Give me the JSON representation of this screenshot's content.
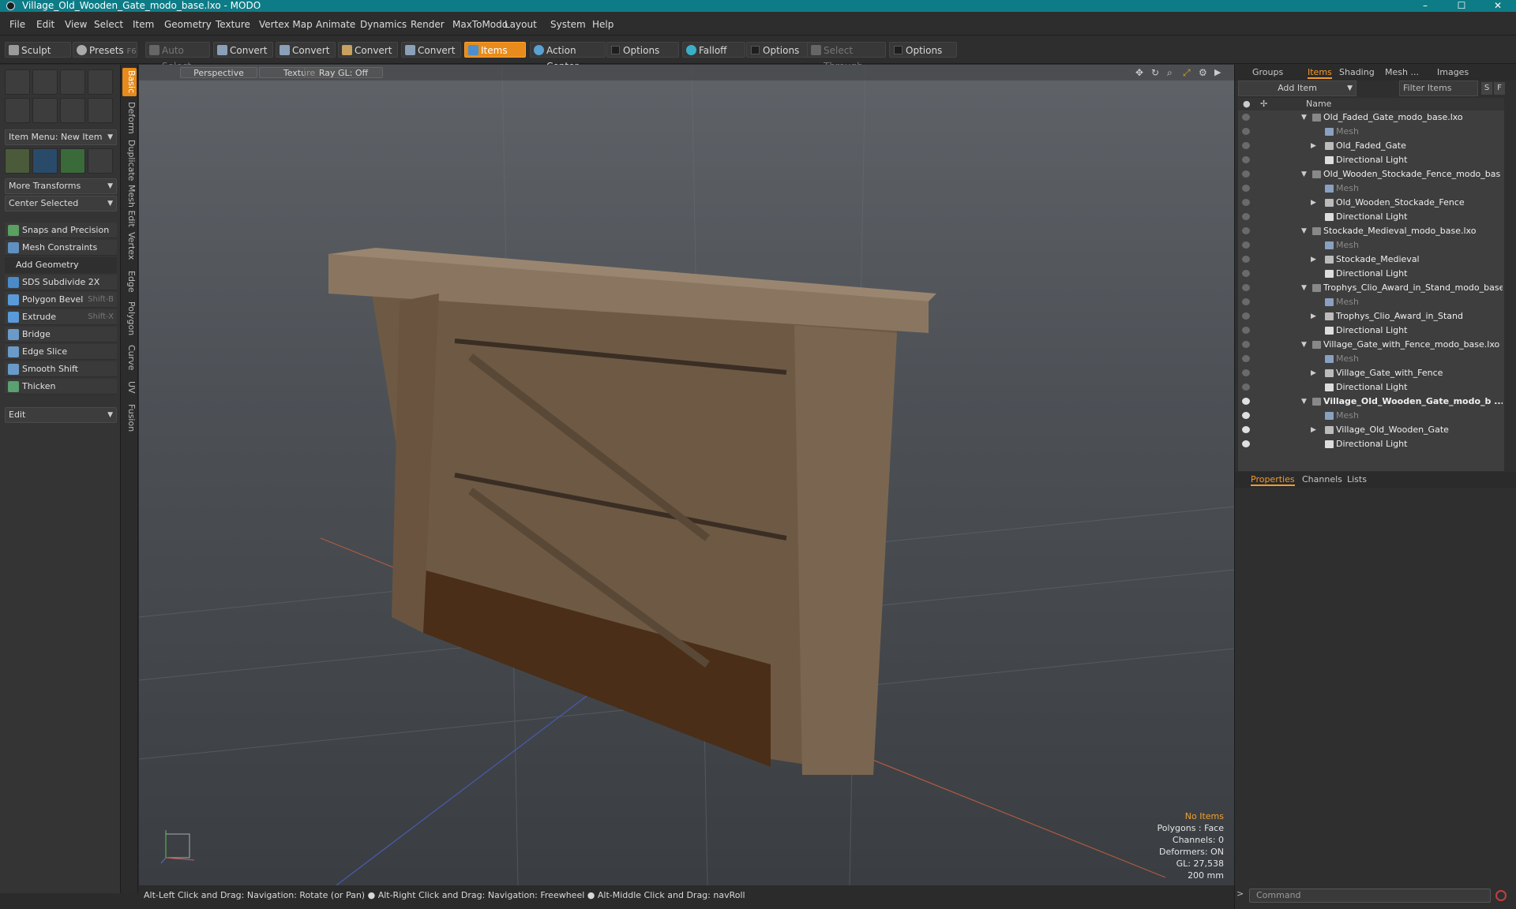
{
  "window": {
    "title": "Village_Old_Wooden_Gate_modo_base.lxo - MODO"
  },
  "menu": [
    "File",
    "Edit",
    "View",
    "Select",
    "Item",
    "Geometry",
    "Texture",
    "Vertex Map",
    "Animate",
    "Dynamics",
    "Render",
    "MaxToModo",
    "Layout",
    "System",
    "Help"
  ],
  "toolbar": {
    "sculpt": "Sculpt",
    "presets": "Presets",
    "presets_key": "F6",
    "auto_select": "Auto Select",
    "convert": "Convert",
    "items": "Items",
    "action_center": "Action Center",
    "options": "Options",
    "falloff": "Falloff",
    "select_through": "Select Through"
  },
  "left": {
    "item_menu": "Item Menu: New Item",
    "more_transforms": "More Transforms",
    "center_selected": "Center Selected",
    "snaps": "Snaps and Precision",
    "mesh_constraints": "Mesh Constraints",
    "add_geometry": "Add Geometry",
    "tools": [
      {
        "label": "SDS Subdivide 2X",
        "key": ""
      },
      {
        "label": "Polygon Bevel",
        "key": "Shift-B"
      },
      {
        "label": "Extrude",
        "key": "Shift-X"
      },
      {
        "label": "Bridge",
        "key": ""
      },
      {
        "label": "Edge Slice",
        "key": ""
      },
      {
        "label": "Smooth Shift",
        "key": ""
      },
      {
        "label": "Thicken",
        "key": ""
      }
    ],
    "edit": "Edit",
    "vtabs": [
      "Basic",
      "Deform",
      "Duplicate",
      "Mesh Edit",
      "Vertex",
      "Edge",
      "Polygon",
      "Curve",
      "UV",
      "Fusion"
    ]
  },
  "viewport": {
    "perspective": "Perspective",
    "texture": "Texture",
    "raygl": "Ray GL: Off",
    "info": {
      "items": "No Items",
      "polygons": "Polygons : Face",
      "channels": "Channels: 0",
      "deformers": "Deformers: ON",
      "gl": "GL: 27,538",
      "scale": "200 mm"
    }
  },
  "status": "Alt-Left Click and Drag: Navigation: Rotate (or Pan) ● Alt-Right Click and Drag: Navigation: Freewheel ● Alt-Middle Click and Drag: navRoll",
  "right": {
    "tabs": [
      "Groups",
      "Items",
      "Shading",
      "Mesh ...",
      "Images"
    ],
    "add_item": "Add Item",
    "filter": "Filter Items",
    "s_btn": "S",
    "f_btn": "F",
    "name_col": "Name",
    "rows": [
      {
        "label": "Old_Faded_Gate_modo_base.lxo",
        "level": 0,
        "type": "scene",
        "eye": false
      },
      {
        "label": "Mesh",
        "level": 1,
        "type": "mesh",
        "dim": true,
        "eye": false
      },
      {
        "label": "Old_Faded_Gate",
        "level": 1,
        "type": "group",
        "exp": true,
        "eye": false
      },
      {
        "label": "Directional Light",
        "level": 1,
        "type": "light",
        "eye": false
      },
      {
        "label": "Old_Wooden_Stockade_Fence_modo_bas ...",
        "level": 0,
        "type": "scene",
        "eye": false
      },
      {
        "label": "Mesh",
        "level": 1,
        "type": "mesh",
        "dim": true,
        "eye": false
      },
      {
        "label": "Old_Wooden_Stockade_Fence",
        "level": 1,
        "type": "group",
        "exp": true,
        "eye": false
      },
      {
        "label": "Directional Light",
        "level": 1,
        "type": "light",
        "eye": false
      },
      {
        "label": "Stockade_Medieval_modo_base.lxo",
        "level": 0,
        "type": "scene",
        "eye": false
      },
      {
        "label": "Mesh",
        "level": 1,
        "type": "mesh",
        "dim": true,
        "eye": false
      },
      {
        "label": "Stockade_Medieval",
        "level": 1,
        "type": "group",
        "exp": true,
        "eye": false
      },
      {
        "label": "Directional Light",
        "level": 1,
        "type": "light",
        "eye": false
      },
      {
        "label": "Trophys_Clio_Award_in_Stand_modo_base...",
        "level": 0,
        "type": "scene",
        "eye": false
      },
      {
        "label": "Mesh",
        "level": 1,
        "type": "mesh",
        "dim": true,
        "eye": false
      },
      {
        "label": "Trophys_Clio_Award_in_Stand",
        "level": 1,
        "type": "group",
        "exp": true,
        "eye": false
      },
      {
        "label": "Directional Light",
        "level": 1,
        "type": "light",
        "eye": false
      },
      {
        "label": "Village_Gate_with_Fence_modo_base.lxo",
        "level": 0,
        "type": "scene",
        "eye": false
      },
      {
        "label": "Mesh",
        "level": 1,
        "type": "mesh",
        "dim": true,
        "eye": false
      },
      {
        "label": "Village_Gate_with_Fence",
        "level": 1,
        "type": "group",
        "exp": true,
        "eye": false
      },
      {
        "label": "Directional Light",
        "level": 1,
        "type": "light",
        "eye": false
      },
      {
        "label": "Village_Old_Wooden_Gate_modo_b ...",
        "level": 0,
        "type": "scene",
        "bold": true,
        "eye": true
      },
      {
        "label": "Mesh",
        "level": 1,
        "type": "mesh",
        "dim": true,
        "eye": true
      },
      {
        "label": "Village_Old_Wooden_Gate",
        "level": 1,
        "type": "group",
        "exp": true,
        "eye": true
      },
      {
        "label": "Directional Light",
        "level": 1,
        "type": "light",
        "eye": true
      }
    ],
    "ptabs": [
      "Properties",
      "Channels",
      "Lists"
    ],
    "command": "Command"
  },
  "colors": {
    "accent": "#e78b1c",
    "titlebar": "#0e7c86"
  }
}
